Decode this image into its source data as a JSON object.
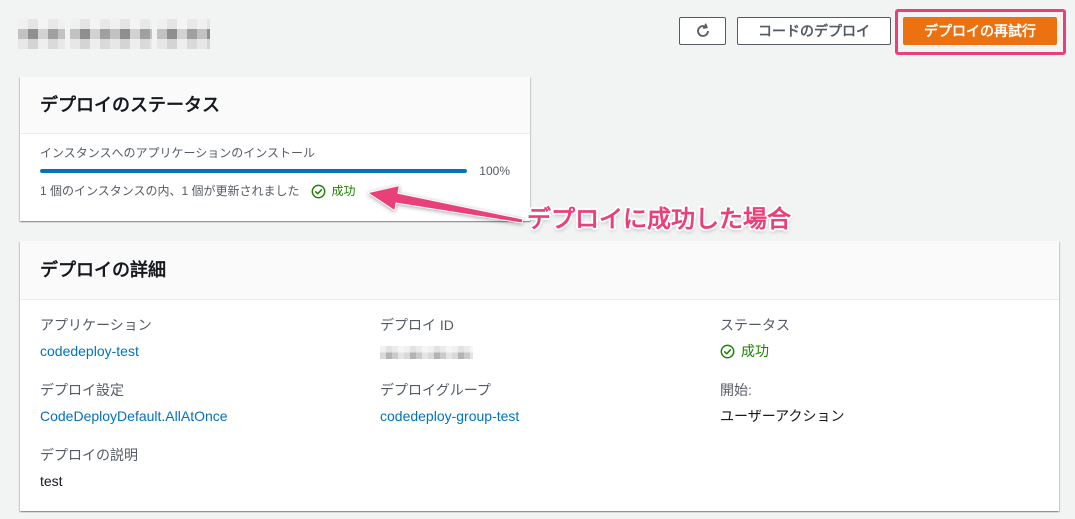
{
  "colors": {
    "primary": "#ec7211",
    "link": "#0073bb",
    "progress": "#0073bb",
    "success": "#1d8102",
    "annotation": "#e9407a"
  },
  "icons": {
    "refresh_button": "refresh-icon",
    "status_success": "check-circle-icon"
  },
  "header": {
    "deploy_code_button": "コードのデプロイ",
    "retry_deployment_button": "デプロイの再試行"
  },
  "status_card": {
    "title": "デプロイのステータス",
    "progress": {
      "label": "インスタンスへのアプリケーションのインストール",
      "value": 100,
      "value_text": "100%"
    },
    "summary": "1 個のインスタンスの内、1 個が更新されました",
    "result": "成功"
  },
  "details_card": {
    "title": "デプロイの詳細",
    "application": {
      "label": "アプリケーション",
      "value": "codedeploy-test"
    },
    "deployment_config": {
      "label": "デプロイ設定",
      "value": "CodeDeployDefault.AllAtOnce"
    },
    "description": {
      "label": "デプロイの説明",
      "value": "test"
    },
    "deployment_id": {
      "label": "デプロイ ID"
    },
    "deployment_group": {
      "label": "デプロイグループ",
      "value": "codedeploy-group-test"
    },
    "status": {
      "label": "ステータス",
      "value": "成功"
    },
    "initiated_by": {
      "label": "開始:",
      "value": "ユーザーアクション"
    }
  },
  "annotation": {
    "text": "デプロイに成功した場合"
  }
}
